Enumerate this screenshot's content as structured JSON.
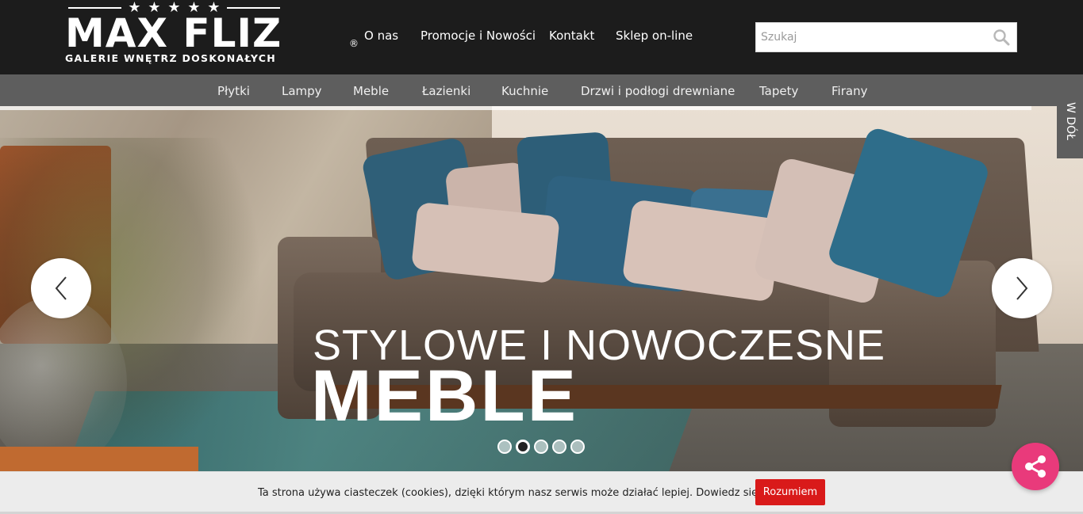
{
  "brand": {
    "wordmark": "MAX FLIZ",
    "registered": "®",
    "tagline": "GALERIE WNĘTRZ DOSKONAŁYCH",
    "stars": 5
  },
  "topnav": {
    "items": [
      {
        "label": "O nas"
      },
      {
        "label": "Promocje i Nowości"
      },
      {
        "label": "Kontakt"
      },
      {
        "label": "Sklep on-line"
      }
    ]
  },
  "search": {
    "placeholder": "Szukaj",
    "icon": "search-icon"
  },
  "categories": {
    "items": [
      {
        "label": "Płytki"
      },
      {
        "label": "Lampy"
      },
      {
        "label": "Meble"
      },
      {
        "label": "Łazienki"
      },
      {
        "label": "Kuchnie"
      },
      {
        "label": "Drzwi i podłogi drewniane"
      },
      {
        "label": "Tapety"
      },
      {
        "label": "Firany"
      }
    ]
  },
  "hero": {
    "line1": "STYLOWE I NOWOCZESNE",
    "line2": "MEBLE",
    "prev_icon": "chevron-left-icon",
    "next_icon": "chevron-right-icon",
    "slides_total": 5,
    "active_slide": 2
  },
  "side_tab": {
    "label": "W DÓŁ"
  },
  "cookie": {
    "message": "Ta strona używa ciasteczek (cookies), dzięki którym nasz serwis może działać lepiej. Dowiedz się więcej",
    "button": "Rozumiem"
  },
  "share": {
    "icon": "share-icon",
    "color": "#e93a7b"
  },
  "colors": {
    "header_bg": "#1c1c1c",
    "category_bg": "#5e5e5e",
    "cookie_button": "#d91a1a"
  }
}
